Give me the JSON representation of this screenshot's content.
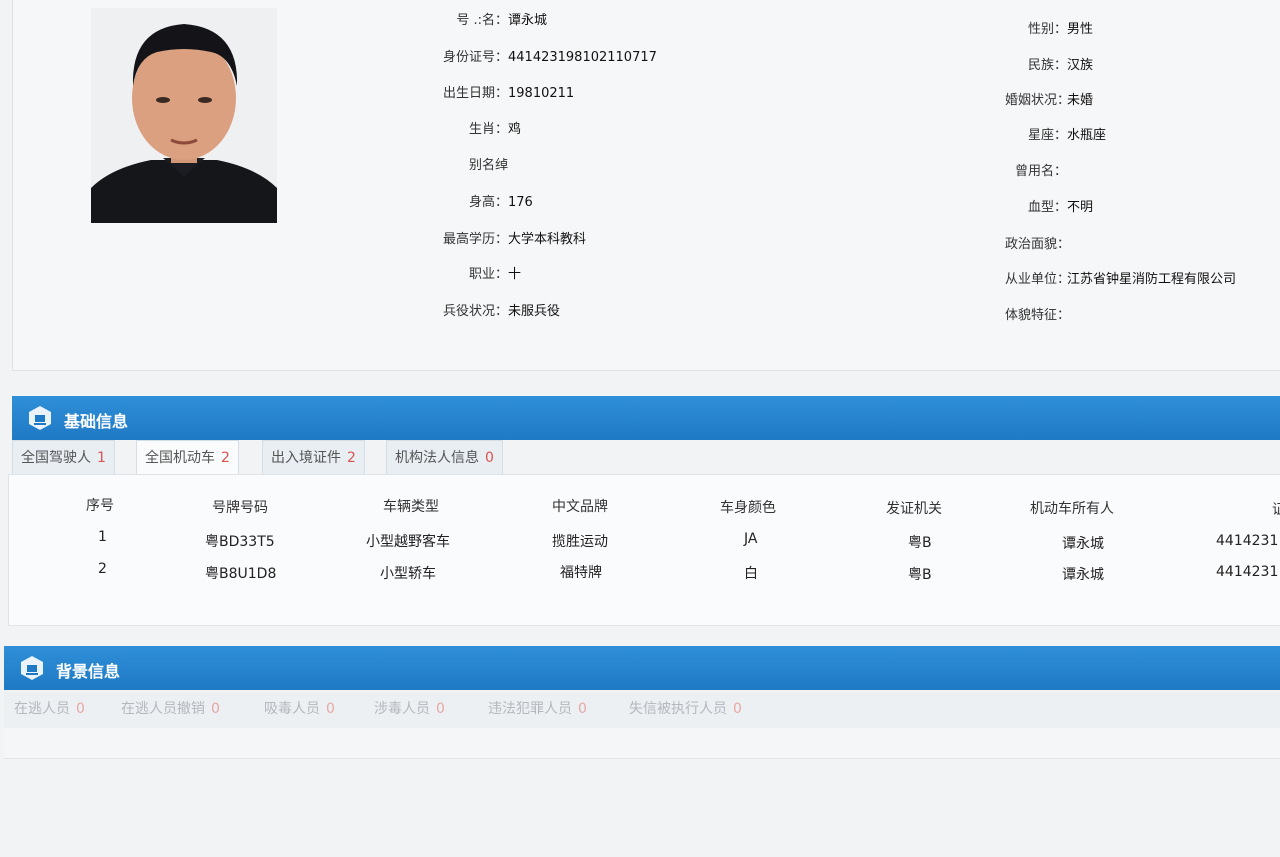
{
  "profile": {
    "left_fields": [
      {
        "label": "号 .:名：",
        "value": "谭永城"
      },
      {
        "label": "身份证号：",
        "value": "441423198102110717"
      },
      {
        "label": "出生日期：",
        "value": "19810211"
      },
      {
        "label": "生肖：",
        "value": "鸡"
      },
      {
        "label": "别名绰",
        "value": ""
      },
      {
        "label": "身高：",
        "value": "176"
      },
      {
        "label": "最高学历：",
        "value": "大学本科教科"
      },
      {
        "label": "职业：",
        "value": "十"
      },
      {
        "label": "兵役状况：",
        "value": "未服兵役"
      }
    ],
    "right_fields": [
      {
        "label": "性别：",
        "value": "男性"
      },
      {
        "label": "民族：",
        "value": "汉族"
      },
      {
        "label": "婚姻状况：",
        "value": "未婚"
      },
      {
        "label": "星座：",
        "value": "水瓶座"
      },
      {
        "label": "曾用名：",
        "value": ""
      },
      {
        "label": "血型：",
        "value": "不明"
      },
      {
        "label": "政治面貌：",
        "value": ""
      },
      {
        "label": "从业单位：",
        "value": "江苏省钟星消防工程有限公司"
      },
      {
        "label": "体貌特征：",
        "value": ""
      }
    ]
  },
  "basic_info": {
    "title": "基础信息",
    "tabs": [
      {
        "label": "全国驾驶人",
        "count": "1"
      },
      {
        "label": "全国机动车",
        "count": "2"
      },
      {
        "label": "出入境证件",
        "count": "2"
      },
      {
        "label": "机构法人信息",
        "count": "0"
      }
    ],
    "columns": [
      "序号",
      "号牌号码",
      "车辆类型",
      "中文品牌",
      "车身颜色",
      "发证机关",
      "机动车所有人",
      "证"
    ],
    "rows": [
      [
        "1",
        "粤BD33T5",
        "小型越野客车",
        "揽胜运动",
        "JA",
        "粤B",
        "谭永城",
        "4414231"
      ],
      [
        "2",
        "粤B8U1D8",
        "小型轿车",
        "福特牌",
        "白",
        "粤B",
        "谭永城",
        "4414231"
      ]
    ]
  },
  "background_info": {
    "title": "背景信息",
    "tabs": [
      {
        "label": "在逃人员",
        "count": "0"
      },
      {
        "label": "在逃人员撤销",
        "count": "0"
      },
      {
        "label": "吸毒人员",
        "count": "0"
      },
      {
        "label": "涉毒人员",
        "count": "0"
      },
      {
        "label": "违法犯罪人员",
        "count": "0"
      },
      {
        "label": "失信被执行人员",
        "count": "0"
      }
    ]
  },
  "colors": {
    "header_blue": "#1f79c4",
    "count_red": "#d9534f"
  }
}
